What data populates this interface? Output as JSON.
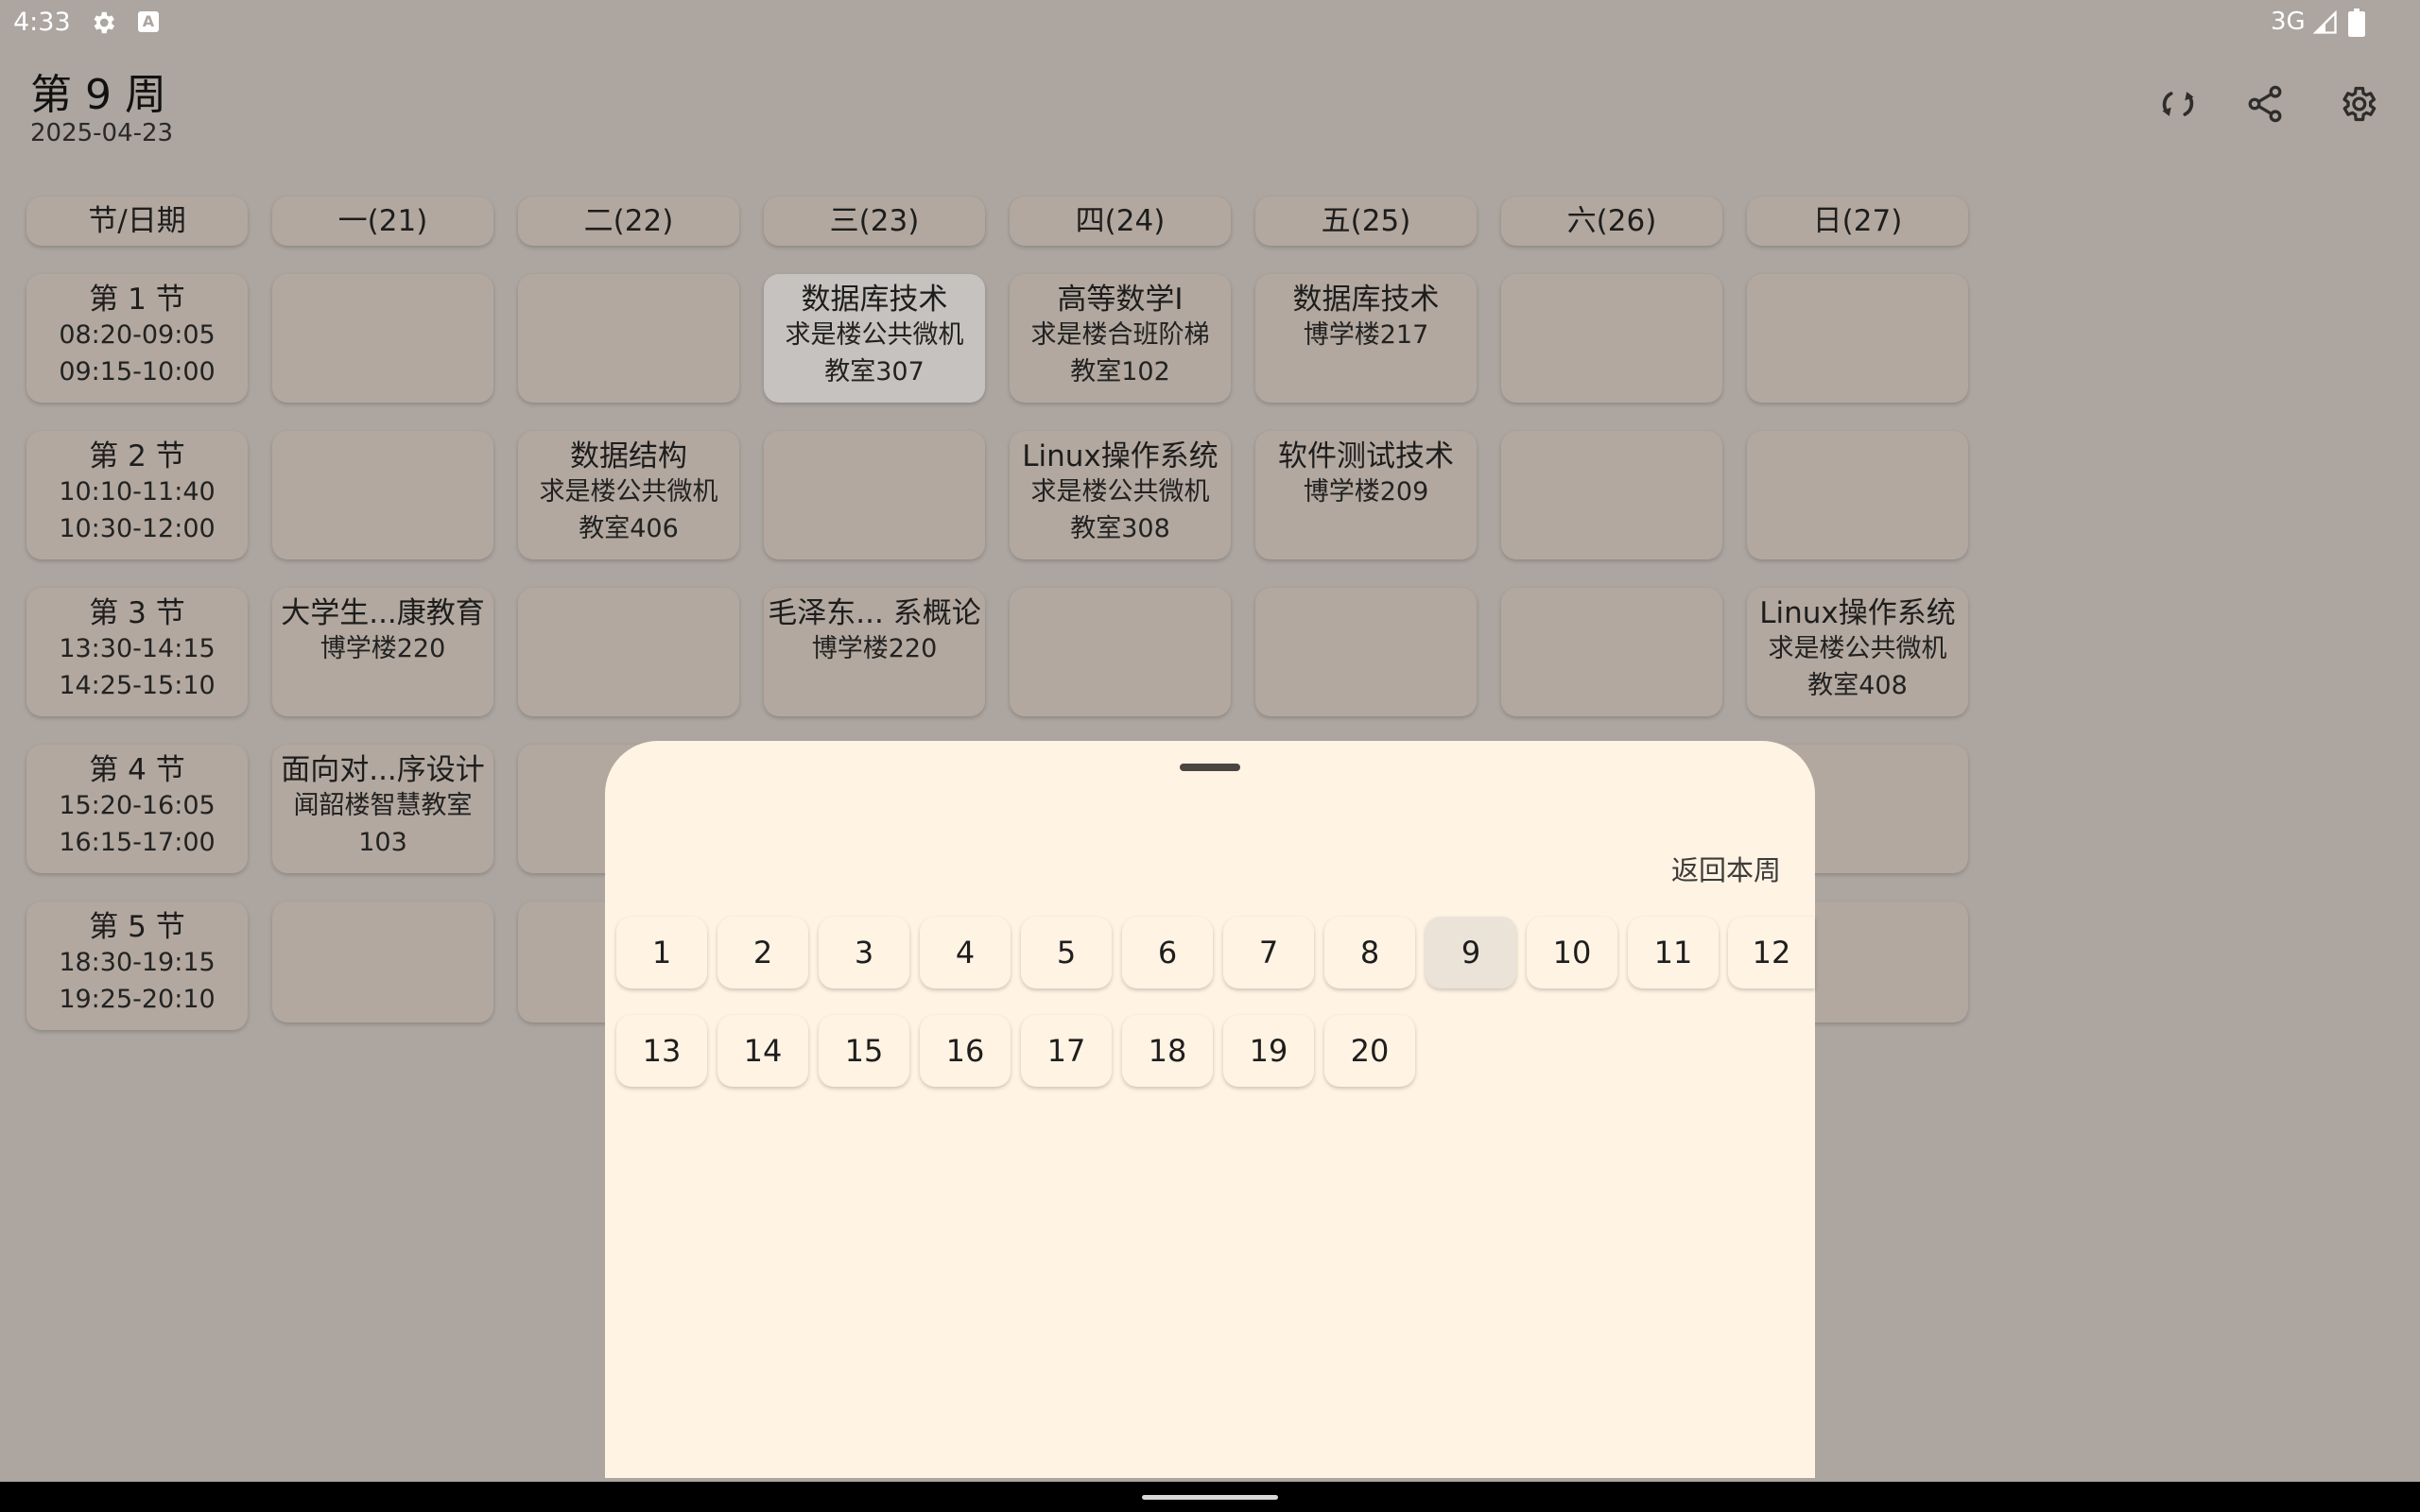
{
  "status_bar": {
    "time": "4:33",
    "network": "3G"
  },
  "header": {
    "title": "第 9 周",
    "date": "2025-04-23"
  },
  "toolbar": {
    "icons": [
      "sync-icon",
      "share-icon",
      "settings-icon"
    ]
  },
  "timetable": {
    "header": [
      "节/日期",
      "一(21)",
      "二(22)",
      "三(23)",
      "四(24)",
      "五(25)",
      "六(26)",
      "日(27)"
    ],
    "periods": [
      {
        "label": "第 1 节",
        "time1": "08:20-09:05",
        "time2": "09:15-10:00"
      },
      {
        "label": "第 2 节",
        "time1": "10:10-11:40",
        "time2": "10:30-12:00"
      },
      {
        "label": "第 3 节",
        "time1": "13:30-14:15",
        "time2": "14:25-15:10"
      },
      {
        "label": "第 4 节",
        "time1": "15:20-16:05",
        "time2": "16:15-17:00"
      },
      {
        "label": "第 5 节",
        "time1": "18:30-19:15",
        "time2": "19:25-20:10"
      }
    ],
    "courses": {
      "p1_d3": {
        "name": "数据库技术",
        "loc1": "求是楼公共微机",
        "loc2": "教室307"
      },
      "p1_d4": {
        "name": "高等数学I",
        "loc1": "求是楼合班阶梯",
        "loc2": "教室102"
      },
      "p1_d5": {
        "name": "数据库技术",
        "loc1": "博学楼217"
      },
      "p2_d2": {
        "name": "数据结构",
        "loc1": "求是楼公共微机",
        "loc2": "教室406"
      },
      "p2_d4": {
        "name": "Linux操作系统",
        "loc1": "求是楼公共微机",
        "loc2": "教室308"
      },
      "p2_d5": {
        "name": "软件测试技术",
        "loc1": "博学楼209"
      },
      "p3_d1": {
        "name": "大学生...康教育",
        "loc1": "博学楼220"
      },
      "p3_d3": {
        "name": "毛泽东... 系概论",
        "loc1": "博学楼220"
      },
      "p3_d7": {
        "name": "Linux操作系统",
        "loc1": "求是楼公共微机",
        "loc2": "教室408"
      },
      "p4_d1": {
        "name": "面向对...序设计",
        "loc1": "闻韶楼智慧教室",
        "loc2": "103"
      }
    }
  },
  "week_sheet": {
    "back_label": "返回本周",
    "selected_week": "9",
    "weeks": [
      "1",
      "2",
      "3",
      "4",
      "5",
      "6",
      "7",
      "8",
      "9",
      "10",
      "11",
      "12",
      "13",
      "14",
      "15",
      "16",
      "17",
      "18",
      "19",
      "20"
    ]
  }
}
